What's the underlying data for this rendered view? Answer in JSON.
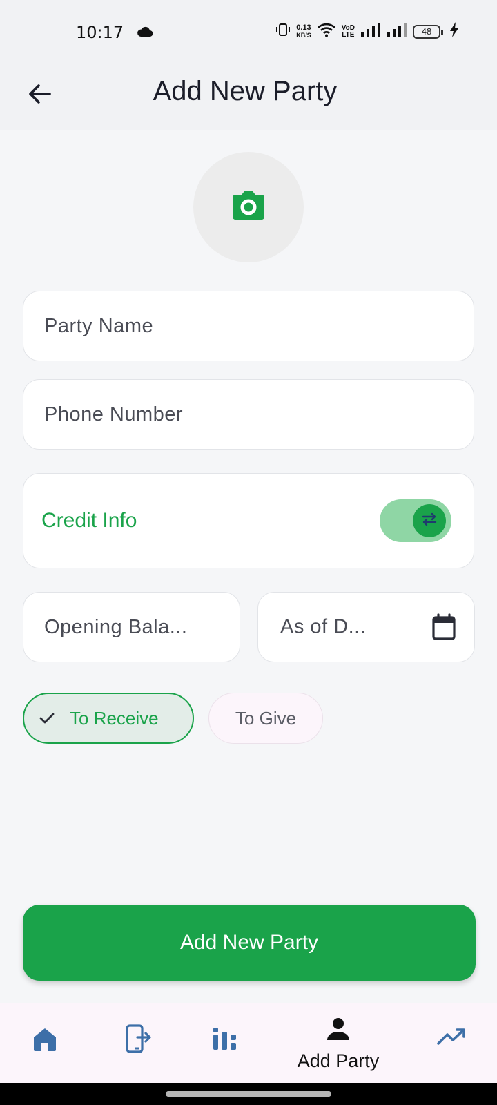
{
  "status_bar": {
    "time": "10:17",
    "net_speed_value": "0.13",
    "net_speed_unit": "KB/S",
    "volte_top": "VoD",
    "volte_bottom": "LTE",
    "battery": "48"
  },
  "app_bar": {
    "title": "Add New Party"
  },
  "form": {
    "party_name_placeholder": "Party Name",
    "phone_number_placeholder": "Phone Number",
    "credit_info_label": "Credit Info",
    "credit_info_enabled": true,
    "opening_balance_placeholder": "Opening Bala...",
    "as_of_date_placeholder": "As of D..."
  },
  "chips": {
    "to_receive": "To Receive",
    "to_give": "To Give",
    "selected": "to_receive"
  },
  "primary_button": {
    "label": "Add New Party"
  },
  "bottom_nav": {
    "items": [
      {
        "icon": "home-icon"
      },
      {
        "icon": "exit-to-app-icon"
      },
      {
        "icon": "stats-icon"
      },
      {
        "icon": "person-icon",
        "label": "Add Party",
        "active": true
      },
      {
        "icon": "trending-up-icon"
      }
    ]
  },
  "colors": {
    "accent": "#1aa34a",
    "toggle_track": "#8fd6a5",
    "nav_icon": "#3d6fa8",
    "nav_background": "#fcf5fb"
  }
}
